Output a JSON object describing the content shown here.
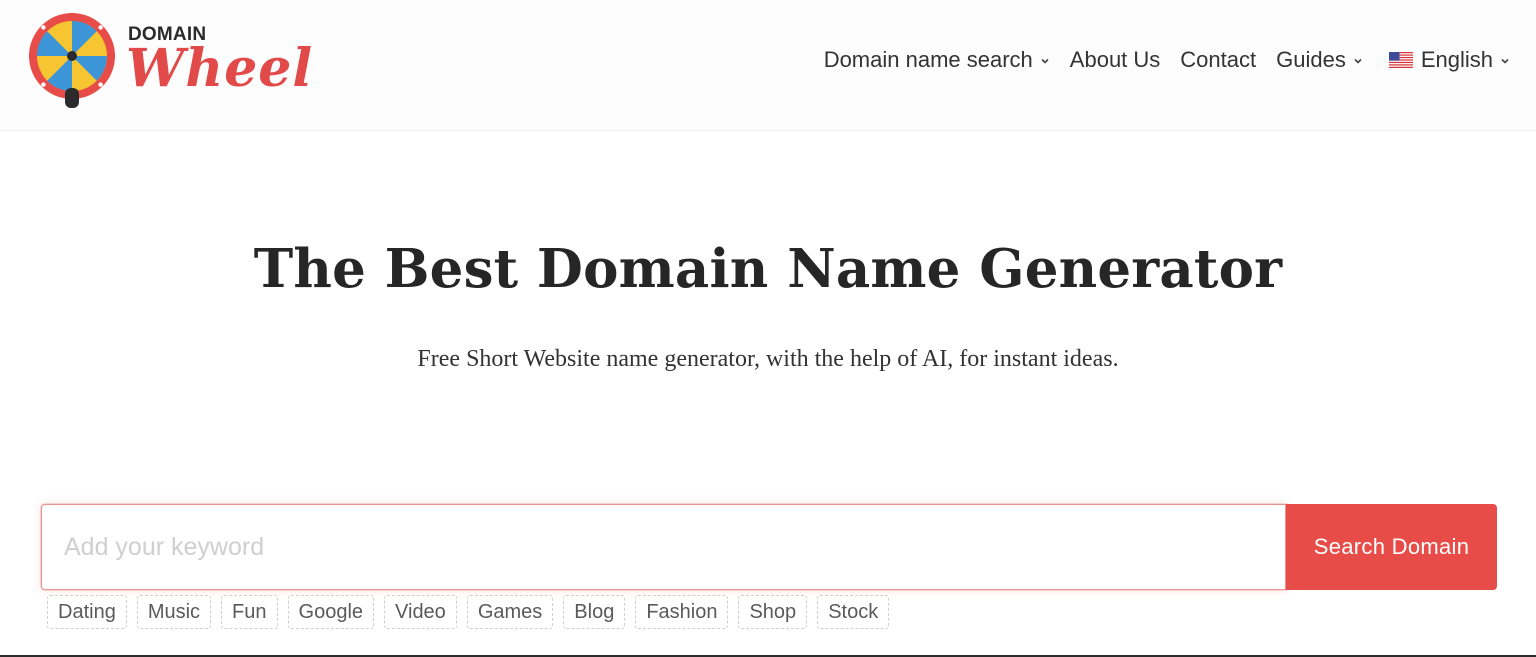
{
  "logo": {
    "top_text": "DOMAIN",
    "main_text": "Wheel",
    "icon": "spinning-wheel-logo",
    "brand_color": "#e24a4a"
  },
  "nav": {
    "items": [
      {
        "label": "Domain name search",
        "has_dropdown": true
      },
      {
        "label": "About Us",
        "has_dropdown": false
      },
      {
        "label": "Contact",
        "has_dropdown": false
      },
      {
        "label": "Guides",
        "has_dropdown": true
      },
      {
        "label": "English",
        "has_dropdown": true,
        "icon": "us-flag-icon"
      }
    ]
  },
  "hero": {
    "title": "The Best Domain Name Generator",
    "subtitle": "Free Short Website name generator, with the help of AI, for instant ideas."
  },
  "search": {
    "placeholder": "Add your keyword",
    "value": "",
    "button_label": "Search Domain",
    "button_color": "#e84c48"
  },
  "tags": [
    "Dating",
    "Music",
    "Fun",
    "Google",
    "Video",
    "Games",
    "Blog",
    "Fashion",
    "Shop",
    "Stock"
  ]
}
